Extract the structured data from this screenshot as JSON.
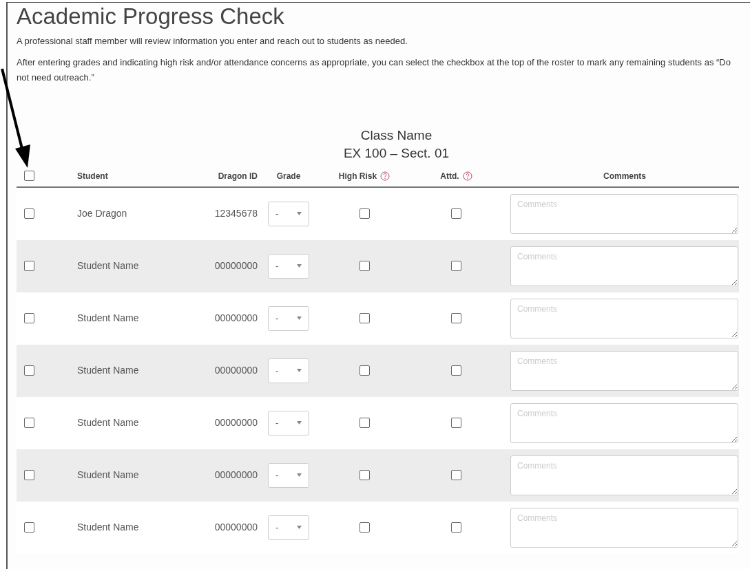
{
  "title": "Academic Progress Check",
  "paragraphs": [
    "A professional staff member will review information you enter and reach out to students as needed.",
    "After entering grades and indicating high risk and/or attendance concerns as appropriate, you can select the checkbox at the top of the roster to mark any remaining students as “Do not need outreach.”"
  ],
  "class_name": "Class Name",
  "section": "EX 100 – Sect. 01",
  "select_all": {
    "checked": false
  },
  "columns": [
    {
      "label": "Student",
      "help": false
    },
    {
      "label": "Dragon ID",
      "help": false
    },
    {
      "label": "Grade",
      "help": false
    },
    {
      "label": "High Risk",
      "help": true
    },
    {
      "label": "Attd.",
      "help": true
    },
    {
      "label": "Comments",
      "help": false
    }
  ],
  "rows": [
    {
      "checked": false,
      "student": "Joe Dragon",
      "dragon_id": "12345678",
      "grade": "-",
      "high_risk": false,
      "attd": false,
      "comments_placeholder": "Comments"
    },
    {
      "checked": false,
      "student": "Student Name",
      "dragon_id": "00000000",
      "grade": "-",
      "high_risk": false,
      "attd": false,
      "comments_placeholder": "Comments"
    },
    {
      "checked": false,
      "student": "Student Name",
      "dragon_id": "00000000",
      "grade": "-",
      "high_risk": false,
      "attd": false,
      "comments_placeholder": "Comments"
    },
    {
      "checked": false,
      "student": "Student Name",
      "dragon_id": "00000000",
      "grade": "-",
      "high_risk": false,
      "attd": false,
      "comments_placeholder": "Comments"
    },
    {
      "checked": false,
      "student": "Student Name",
      "dragon_id": "00000000",
      "grade": "-",
      "high_risk": false,
      "attd": false,
      "comments_placeholder": "Comments"
    },
    {
      "checked": false,
      "student": "Student Name",
      "dragon_id": "00000000",
      "grade": "-",
      "high_risk": false,
      "attd": false,
      "comments_placeholder": "Comments"
    },
    {
      "checked": false,
      "student": "Student Name",
      "dragon_id": "00000000",
      "grade": "-",
      "high_risk": false,
      "attd": false,
      "comments_placeholder": "Comments"
    }
  ]
}
